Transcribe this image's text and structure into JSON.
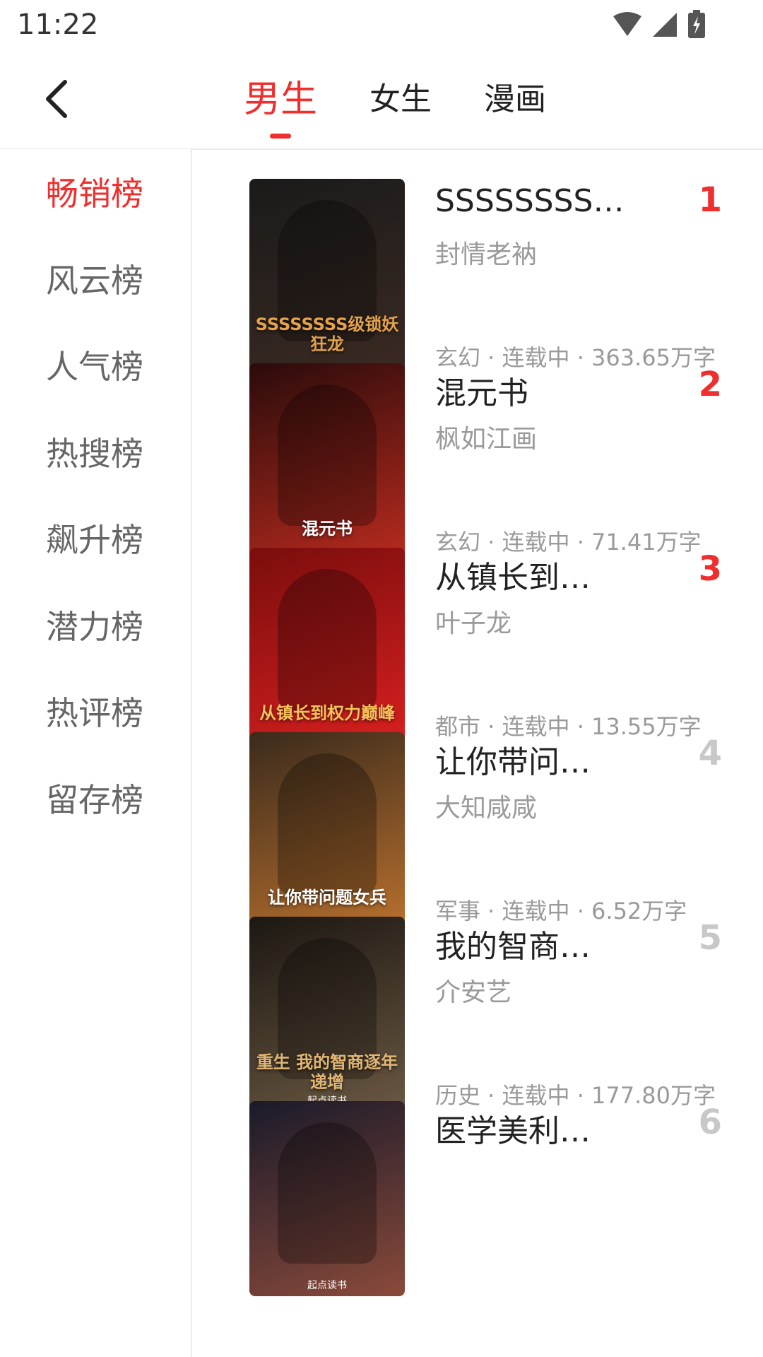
{
  "status": {
    "time": "11:22"
  },
  "header": {
    "tabs": [
      {
        "label": "男生",
        "active": true
      },
      {
        "label": "女生",
        "active": false
      },
      {
        "label": "漫画",
        "active": false
      }
    ]
  },
  "sidebar": {
    "items": [
      {
        "label": "畅销榜",
        "active": true
      },
      {
        "label": "风云榜"
      },
      {
        "label": "人气榜"
      },
      {
        "label": "热搜榜"
      },
      {
        "label": "飙升榜"
      },
      {
        "label": "潜力榜"
      },
      {
        "label": "热评榜"
      },
      {
        "label": "留存榜"
      }
    ]
  },
  "colors": {
    "accent": "#f02e2e",
    "rank_muted": "#c8c8c8"
  },
  "books": [
    {
      "title": "SSSSSSSS…",
      "author": "封情老衲",
      "meta": "玄幻 · 连载中 · 363.65万字",
      "rank": "1",
      "cover": {
        "text": "SSSSSSSS级锁妖狂龙",
        "brand": "",
        "bg1": "#1a1a1a",
        "bg2": "#3b2a22",
        "fg": "#e3a24b"
      }
    },
    {
      "title": "混元书",
      "author": "枫如江画",
      "meta": "玄幻 · 连载中 · 71.41万字",
      "rank": "2",
      "cover": {
        "text": "混元书",
        "brand": "",
        "bg1": "#2a0b0b",
        "bg2": "#b82a1e",
        "fg": "#ffffff"
      }
    },
    {
      "title": "从镇长到…",
      "author": "叶子龙",
      "meta": "都市 · 连载中 · 13.55万字",
      "rank": "3",
      "cover": {
        "text": "从镇长到权力巅峰",
        "brand": "",
        "bg1": "#7a0d0d",
        "bg2": "#d81f1f",
        "fg": "#f5c35a"
      }
    },
    {
      "title": "让你带问…",
      "author": "大知咸咸",
      "meta": "军事 · 连载中 · 6.52万字",
      "rank": "4",
      "cover": {
        "text": "让你带问题女兵",
        "brand": "",
        "bg1": "#3a2a1c",
        "bg2": "#b8702d",
        "fg": "#ffffff"
      }
    },
    {
      "title": "我的智商…",
      "author": "介安艺",
      "meta": "历史 · 连载中 · 177.80万字",
      "rank": "5",
      "cover": {
        "text": "重生 我的智商逐年递增",
        "brand": "起点读书",
        "bg1": "#1c1712",
        "bg2": "#6a5842",
        "fg": "#e2b674"
      }
    },
    {
      "title": "医学美利…",
      "author": "",
      "meta": "",
      "rank": "6",
      "cover": {
        "text": "",
        "brand": "起点读书",
        "bg1": "#1a1a2a",
        "bg2": "#8a4a3a",
        "fg": "#ffffff"
      }
    }
  ]
}
